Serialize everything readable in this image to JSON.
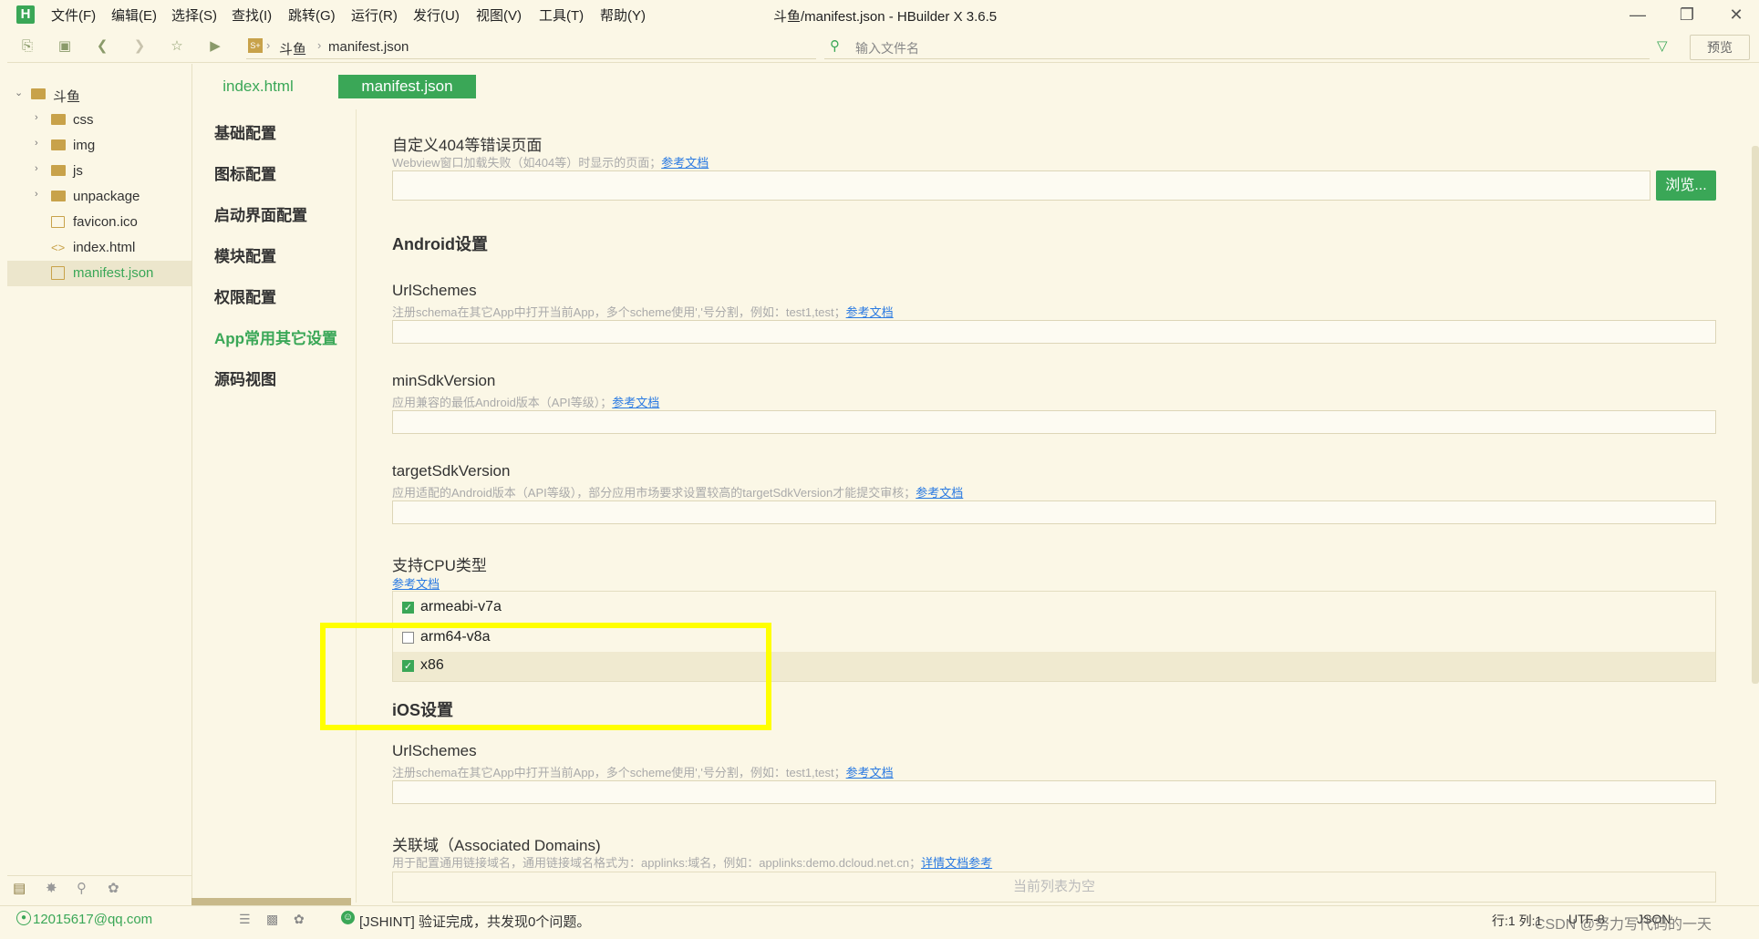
{
  "app": {
    "title": "斗鱼/manifest.json - HBuilder X 3.6.5",
    "logo_letter": "H"
  },
  "menu": [
    "文件(F)",
    "编辑(E)",
    "选择(S)",
    "查找(I)",
    "跳转(G)",
    "运行(R)",
    "发行(U)",
    "视图(V)",
    "工具(T)",
    "帮助(Y)"
  ],
  "toolbar": {
    "breadcrumb": [
      "斗鱼",
      "manifest.json"
    ],
    "file_search_placeholder": "输入文件名",
    "preview_label": "预览"
  },
  "project_tree": {
    "root": "斗鱼",
    "items": [
      {
        "label": "css",
        "type": "folder"
      },
      {
        "label": "img",
        "type": "folder"
      },
      {
        "label": "js",
        "type": "folder"
      },
      {
        "label": "unpackage",
        "type": "folder"
      },
      {
        "label": "favicon.ico",
        "type": "image"
      },
      {
        "label": "index.html",
        "type": "html"
      },
      {
        "label": "manifest.json",
        "type": "json",
        "selected": true
      }
    ]
  },
  "editor_tabs": [
    {
      "label": "index.html",
      "active": false
    },
    {
      "label": "manifest.json",
      "active": true
    }
  ],
  "config_nav": [
    {
      "label": "基础配置",
      "active": false
    },
    {
      "label": "图标配置",
      "active": false
    },
    {
      "label": "启动界面配置",
      "active": false
    },
    {
      "label": "模块配置",
      "active": false
    },
    {
      "label": "权限配置",
      "active": false
    },
    {
      "label": "App常用其它设置",
      "active": true
    },
    {
      "label": "源码视图",
      "active": false
    }
  ],
  "content": {
    "error_page": {
      "label": "自定义404等错误页面",
      "desc": "Webview窗口加载失败（如404等）时显示的页面；",
      "link": "参考文档",
      "browse_label": "浏览..."
    },
    "android_section": "Android设置",
    "android_urlschemes": {
      "label": "UrlSchemes",
      "desc": "注册schema在其它App中打开当前App，多个scheme使用','号分割，例如：test1,test；",
      "link": "参考文档"
    },
    "min_sdk": {
      "label": "minSdkVersion",
      "desc": "应用兼容的最低Android版本（API等级）；",
      "link": "参考文档"
    },
    "target_sdk": {
      "label": "targetSdkVersion",
      "desc": "应用适配的Android版本（API等级），部分应用市场要求设置较高的targetSdkVersion才能提交审核；",
      "link": "参考文档"
    },
    "cpu": {
      "label": "支持CPU类型",
      "link": "参考文档",
      "options": [
        {
          "label": "armeabi-v7a",
          "checked": true
        },
        {
          "label": "arm64-v8a",
          "checked": false
        },
        {
          "label": "x86",
          "checked": true
        }
      ]
    },
    "ios_section": "iOS设置",
    "ios_urlschemes": {
      "label": "UrlSchemes",
      "desc": "注册schema在其它App中打开当前App，多个scheme使用','号分割，例如：test1,test；",
      "link": "参考文档"
    },
    "associated_domains": {
      "label": "关联域（Associated Domains)",
      "desc": "用于配置通用链接域名，通用链接域名格式为：applinks:域名，例如：applinks:demo.dcloud.net.cn；",
      "link": "详情文档参考",
      "empty": "当前列表为空"
    }
  },
  "status": {
    "user": "12015617@qq.com",
    "message": "[JSHINT] 验证完成，共发现0个问题。",
    "position": "行:1   列:1",
    "encoding": "UTF-8",
    "lang": "JSON",
    "watermark": "CSDN @努力写代码的一天"
  },
  "colors": {
    "accent": "#3aa757",
    "background": "#fbf7e6",
    "highlight_box": "#ffff00",
    "link": "#2a7ae2"
  }
}
